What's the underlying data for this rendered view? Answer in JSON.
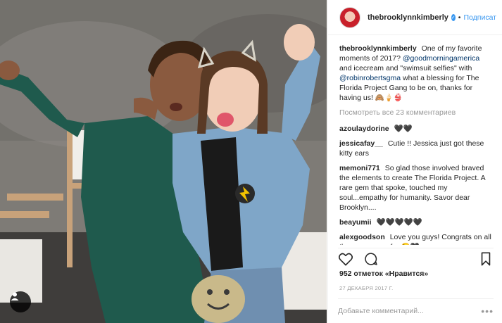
{
  "header": {
    "username": "thebrooklynnkimberly",
    "separator": "•",
    "follow_label": "Подписат"
  },
  "caption": {
    "username": "thebrooklynnkimberly",
    "text1": "One of my favorite moments of 2017?",
    "mention1": "@goodmorningamerica",
    "text2": "and icecream and \"swimsuit selfies\" with",
    "mention2": "@robinrobertsgma",
    "text3": "what a blessing for The Florida Project Gang to be on, thanks for having us! 🙈🍦👙"
  },
  "view_all_comments": "Посмотреть все 23 комментариев",
  "comments": [
    {
      "user": "azoulaydorine",
      "text": "🖤🖤"
    },
    {
      "user": "jessicafay__",
      "text": "Cutie !! Jessica just got these kitty ears"
    },
    {
      "user": "memoni771",
      "text": "So glad those involved braved the elements to create The Florida Project. A rare gem that spoke, touched my soul...empathy for humanity. Savor dear Brooklyn...."
    },
    {
      "user": "beayumii",
      "text": "🖤🖤🖤🖤🖤"
    },
    {
      "user": "alexgoodson",
      "text": "Love you guys! Congrats on all the success so far 😉🖤"
    }
  ],
  "likes": "952 отметок «Нравится»",
  "date": "27 ДЕКАБРЯ 2017 Г.",
  "add_comment_placeholder": "Добавьте комментарий...",
  "more_label": "•••",
  "icons": {
    "like": "heart-icon",
    "comment": "speech-bubble-icon",
    "save": "bookmark-icon",
    "user_tag": "person-icon",
    "verified": "checkmark-icon"
  },
  "colors": {
    "link": "#3897f0",
    "mention": "#003569",
    "muted": "#999999",
    "dress": "#1f5a4d",
    "jacket": "#7fa6c8"
  }
}
